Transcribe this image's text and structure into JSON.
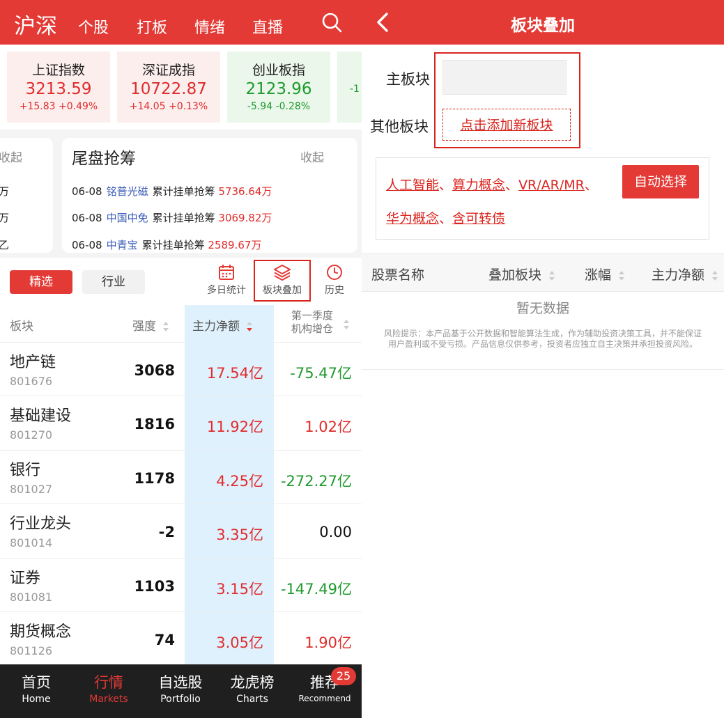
{
  "left": {
    "header": {
      "title": "沪深",
      "tabs": [
        "个股",
        "打板",
        "情绪",
        "直播"
      ]
    },
    "indices": [
      {
        "name": "上证指数",
        "value": "3213.59",
        "change": "+15.83 +0.49%",
        "trend": "up"
      },
      {
        "name": "深证成指",
        "value": "10722.87",
        "change": "+14.05 +0.13%",
        "trend": "up"
      },
      {
        "name": "创业板指",
        "value": "2123.96",
        "change": "-5.94 -0.28%",
        "trend": "down"
      },
      {
        "name": "",
        "value": "",
        "change": "-1",
        "trend": "down"
      }
    ],
    "partial_card": {
      "collapse": "收起",
      "units": [
        "万",
        "万",
        "乙"
      ]
    },
    "bidding": {
      "title": "尾盘抢筹",
      "collapse": "收起",
      "items": [
        {
          "date": "06-08",
          "stock": "铭普光磁",
          "desc": "累计挂单抢筹",
          "amount": "5736.64万"
        },
        {
          "date": "06-08",
          "stock": "中国中免",
          "desc": "累计挂单抢筹",
          "amount": "3069.82万"
        },
        {
          "date": "06-08",
          "stock": "中青宝",
          "desc": "累计挂单抢筹",
          "amount": "2589.67万"
        }
      ]
    },
    "filters": {
      "selected": "精选",
      "industry": "行业"
    },
    "tools": {
      "multi_day": "多日统计",
      "overlay": "板块叠加",
      "history": "历史"
    },
    "table": {
      "headers": {
        "sector": "板块",
        "strength": "强度",
        "main_net": "主力净额",
        "q1": "第一季度",
        "q1_sub": "机构增仓"
      },
      "rows": [
        {
          "name": "地产链",
          "code": "801676",
          "strength": "3068",
          "main_net": "17.54亿",
          "q1": "-75.47亿",
          "q1_sign": "neg"
        },
        {
          "name": "基础建设",
          "code": "801270",
          "strength": "1816",
          "main_net": "11.92亿",
          "q1": "1.02亿",
          "q1_sign": "pos"
        },
        {
          "name": "银行",
          "code": "801027",
          "strength": "1178",
          "main_net": "4.25亿",
          "q1": "-272.27亿",
          "q1_sign": "neg"
        },
        {
          "name": "行业龙头",
          "code": "801014",
          "strength": "-2",
          "main_net": "3.35亿",
          "q1": "0.00",
          "q1_sign": "zero"
        },
        {
          "name": "证券",
          "code": "801081",
          "strength": "1103",
          "main_net": "3.15亿",
          "q1": "-147.49亿",
          "q1_sign": "neg"
        },
        {
          "name": "期货概念",
          "code": "801126",
          "strength": "74",
          "main_net": "3.05亿",
          "q1": "1.90亿",
          "q1_sign": "pos"
        }
      ]
    },
    "bottom_nav": [
      {
        "cn": "首页",
        "en": "Home"
      },
      {
        "cn": "行情",
        "en": "Markets"
      },
      {
        "cn": "自选股",
        "en": "Portfolio"
      },
      {
        "cn": "龙虎榜",
        "en": "Charts"
      },
      {
        "cn": "推荐",
        "en": "Recommend"
      }
    ],
    "badge": "25"
  },
  "right": {
    "header": {
      "title": "板块叠加"
    },
    "main_label": "主板块",
    "other_label": "其他板块",
    "add_link": "点击添加新板块",
    "suggestions": {
      "line1": [
        "人工智能",
        "算力概念",
        "VR/AR/MR"
      ],
      "line2": [
        "华为概念",
        "含可转债"
      ],
      "sep": "、",
      "auto_button": "自动选择"
    },
    "table_headers": {
      "stock": "股票名称",
      "overlay": "叠加板块",
      "change": "涨幅",
      "main_net": "主力净额"
    },
    "empty": "暂无数据",
    "risk": "风险提示：本产品基于公开数据和智能算法生成，作为辅助投资决策工具，并不能保证用户盈利或不受亏损。产品信息仅供参考，投资者应独立自主决策并承担投资风险。"
  },
  "colors": {
    "brand_red": "#e33a36",
    "up": "#e02c2c",
    "down": "#1f9a2e",
    "highlight_col": "#dff1fd",
    "link_blue": "#3b5cb8"
  }
}
